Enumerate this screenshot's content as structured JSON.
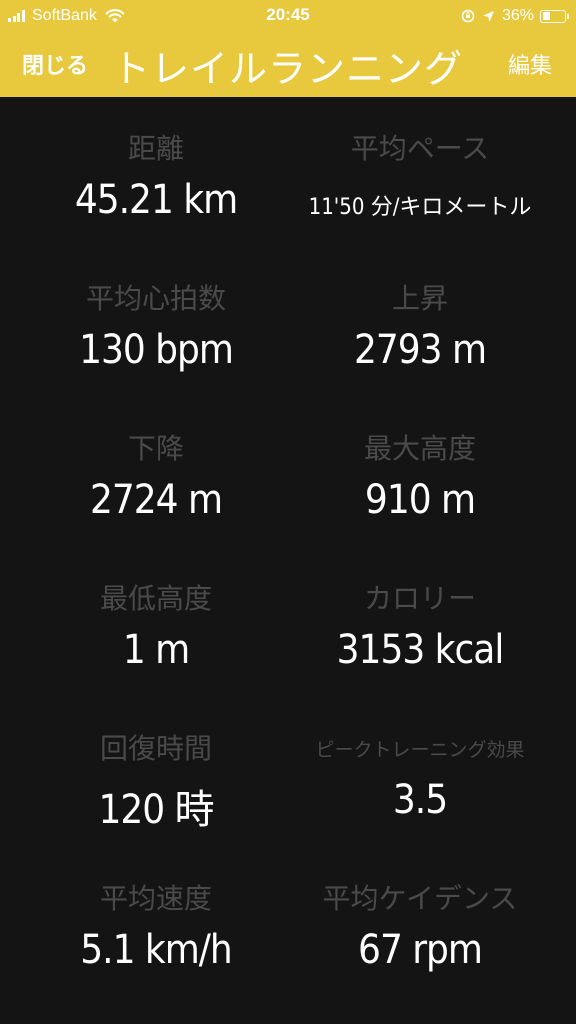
{
  "status_bar": {
    "carrier": "SoftBank",
    "time": "20:45",
    "battery_percent": "36%",
    "battery_level": 0.36,
    "signal_bars": 4
  },
  "nav": {
    "close_label": "閉じる",
    "title": "トレイルランニング",
    "edit_label": "編集",
    "accent_color": "#e8c93e"
  },
  "stats": [
    {
      "label": "距離",
      "value": "45.21 km"
    },
    {
      "label": "平均ペース",
      "value": "11'50 分/キロメートル"
    },
    {
      "label": "平均心拍数",
      "value": "130 bpm"
    },
    {
      "label": "上昇",
      "value": "2793 m"
    },
    {
      "label": "下降",
      "value": "2724 m"
    },
    {
      "label": "最大高度",
      "value": "910 m"
    },
    {
      "label": "最低高度",
      "value": "1 m"
    },
    {
      "label": "カロリー",
      "value": "3153 kcal"
    },
    {
      "label": "回復時間",
      "value": "120 時"
    },
    {
      "label": "ピークトレーニング効果",
      "value": "3.5"
    },
    {
      "label": "平均速度",
      "value": "5.1 km/h"
    },
    {
      "label": "平均ケイデンス",
      "value": "67 rpm"
    }
  ]
}
